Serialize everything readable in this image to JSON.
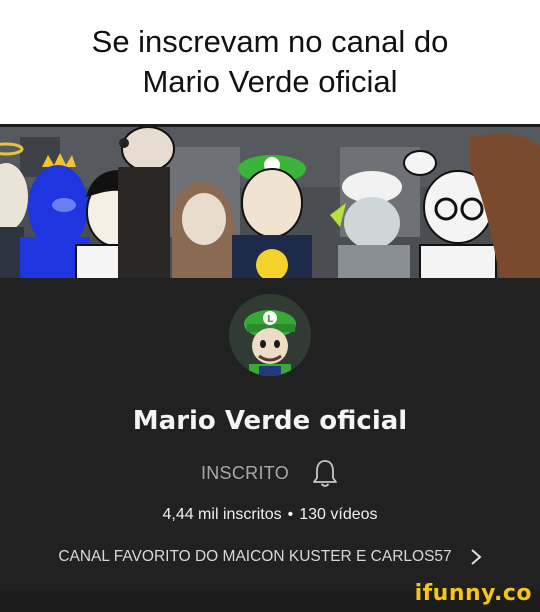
{
  "caption": {
    "line1": "Se inscrevam no canal do",
    "line2": "Mario Verde oficial"
  },
  "channel": {
    "name": "Mario Verde oficial",
    "subscribe_label": "INSCRITO",
    "subscribers": "4,44 mil inscritos",
    "separator": "•",
    "videos": "130 vídeos",
    "featured_label": "CANAL FAVORITO DO MAICON KUSTER E CARLOS57",
    "bell_icon": "bell-icon",
    "chevron_icon": "chevron-right-icon"
  },
  "banner": {
    "avatar_cap_letter": "L"
  },
  "watermark": "ifunny.co",
  "colors": {
    "channel_bg": "#212121",
    "luigi_green": "#3a9a2c",
    "watermark": "#f5c518"
  }
}
